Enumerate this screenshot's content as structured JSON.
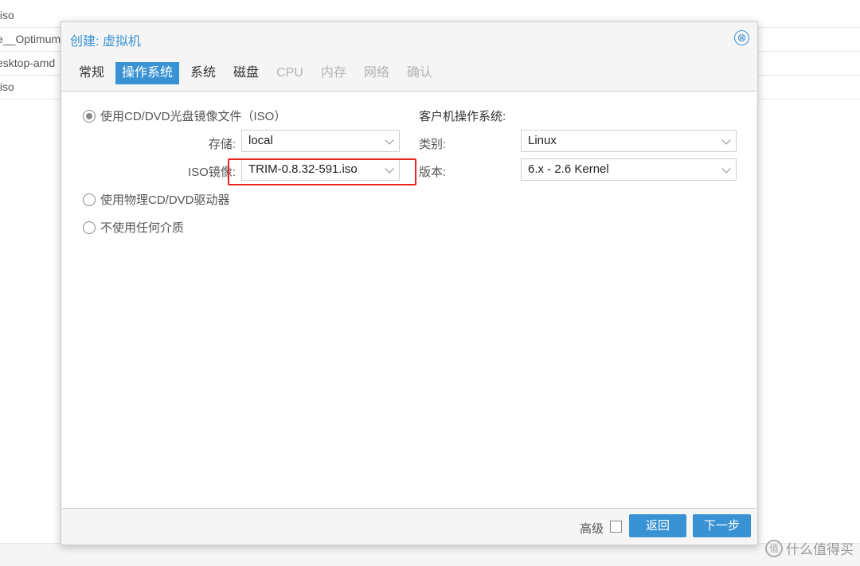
{
  "background": {
    "rows": [
      ".iso",
      "e__Optimum",
      "esktop-amd",
      ".iso"
    ]
  },
  "dialog": {
    "title": "创建: 虚拟机",
    "close_icon": "⊗",
    "tabs": [
      {
        "label": "常规",
        "state": "normal"
      },
      {
        "label": "操作系统",
        "state": "active"
      },
      {
        "label": "系统",
        "state": "normal"
      },
      {
        "label": "磁盘",
        "state": "normal"
      },
      {
        "label": "CPU",
        "state": "disabled"
      },
      {
        "label": "内存",
        "state": "disabled"
      },
      {
        "label": "网络",
        "state": "disabled"
      },
      {
        "label": "确认",
        "state": "disabled"
      }
    ],
    "media": {
      "option_iso": "使用CD/DVD光盘镜像文件（ISO）",
      "storage_label": "存储:",
      "storage_value": "local",
      "iso_label": "ISO镜像:",
      "iso_value": "TRIM-0.8.32-591.iso",
      "option_physical": "使用物理CD/DVD驱动器",
      "option_none": "不使用任何介质",
      "selected": "iso"
    },
    "guest_os": {
      "title": "客户机操作系统:",
      "type_label": "类别:",
      "type_value": "Linux",
      "version_label": "版本:",
      "version_value": "6.x - 2.6 Kernel"
    },
    "footer": {
      "advanced_label": "高级",
      "advanced_checked": false,
      "back_label": "返回",
      "next_label": "下一步"
    }
  },
  "watermark": {
    "icon": "值",
    "text": "什么值得买"
  },
  "colors": {
    "accent": "#3892d4",
    "highlight": "#e8251f"
  }
}
